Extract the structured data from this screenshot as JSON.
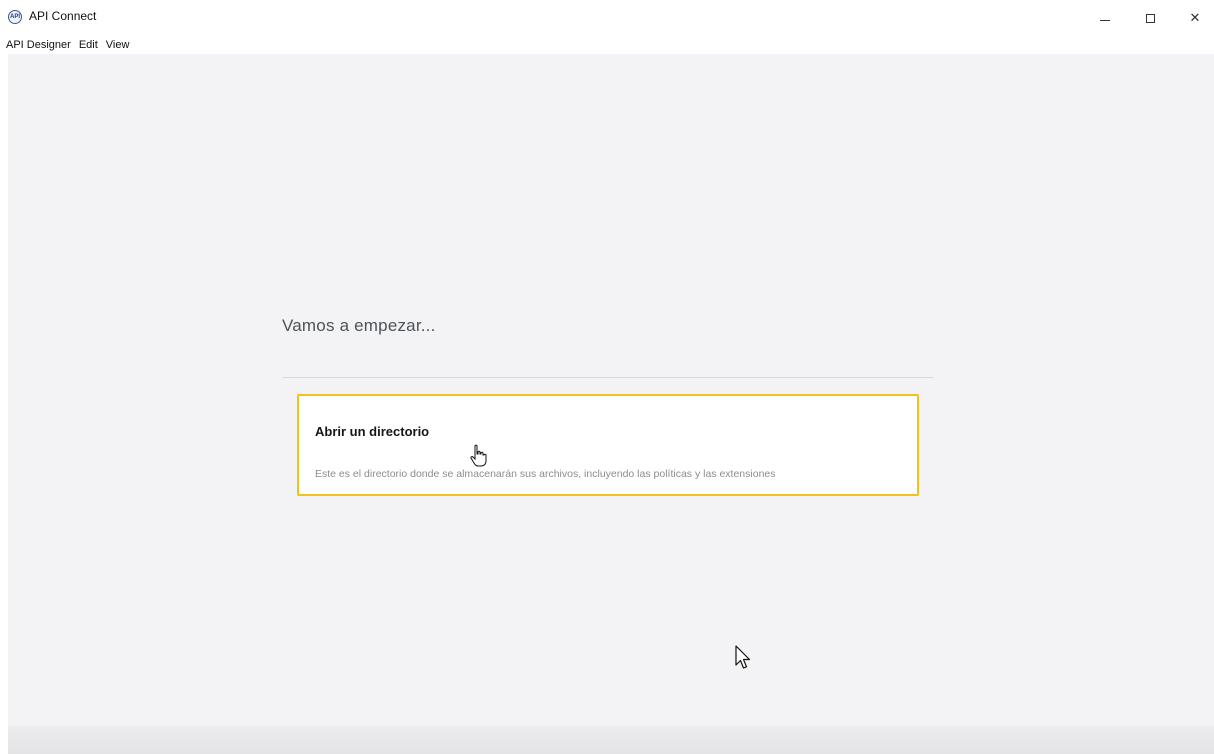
{
  "window": {
    "title": "API Connect",
    "icon": "api-connect-logo-icon",
    "icon_text": "API",
    "controls": {
      "minimize": "minimize-icon",
      "maximize": "maximize-icon",
      "close": "close-icon",
      "close_glyph": "✕"
    }
  },
  "menubar": {
    "items": [
      "API Designer",
      "Edit",
      "View"
    ]
  },
  "main": {
    "heading": "Vamos a empezar...",
    "tile": {
      "title": "Abrir un directorio",
      "description": "Este es el directorio donde se almacenarán sus archivos, incluyendo las políticas y las extensiones"
    }
  },
  "colors": {
    "tile_border": "#f1c21b",
    "background": "#f3f3f5"
  }
}
